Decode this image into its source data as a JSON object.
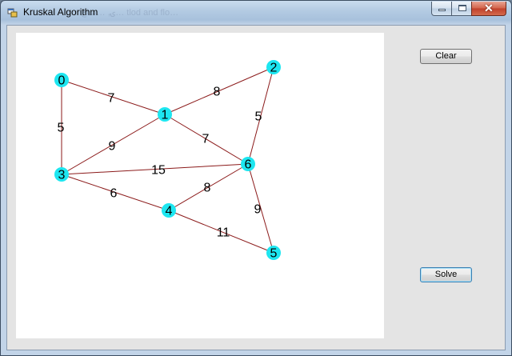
{
  "window": {
    "title": "Kruskal Algorithm",
    "ghost_title": "ۍ, …ساح… tlod and flo…",
    "close_glyph": "✕"
  },
  "buttons": {
    "clear_label": "Clear",
    "solve_label": "Solve"
  },
  "colors": {
    "node_fill": "#1de6f0",
    "edge_stroke": "#8b1a1a",
    "canvas_bg": "#ffffff",
    "form_bg": "#e4e4e4"
  },
  "graph": {
    "nodes": [
      {
        "id": "0"
      },
      {
        "id": "1"
      },
      {
        "id": "2"
      },
      {
        "id": "3"
      },
      {
        "id": "4"
      },
      {
        "id": "5"
      },
      {
        "id": "6"
      }
    ],
    "edges": [
      {
        "from": "0",
        "to": "1",
        "weight": "7"
      },
      {
        "from": "1",
        "to": "2",
        "weight": "8"
      },
      {
        "from": "0",
        "to": "3",
        "weight": "5"
      },
      {
        "from": "1",
        "to": "3",
        "weight": "9"
      },
      {
        "from": "1",
        "to": "6",
        "weight": "7"
      },
      {
        "from": "2",
        "to": "6",
        "weight": "5"
      },
      {
        "from": "3",
        "to": "6",
        "weight": "15"
      },
      {
        "from": "3",
        "to": "4",
        "weight": "6"
      },
      {
        "from": "4",
        "to": "6",
        "weight": "8"
      },
      {
        "from": "6",
        "to": "5",
        "weight": "9"
      },
      {
        "from": "4",
        "to": "5",
        "weight": "11"
      }
    ]
  }
}
